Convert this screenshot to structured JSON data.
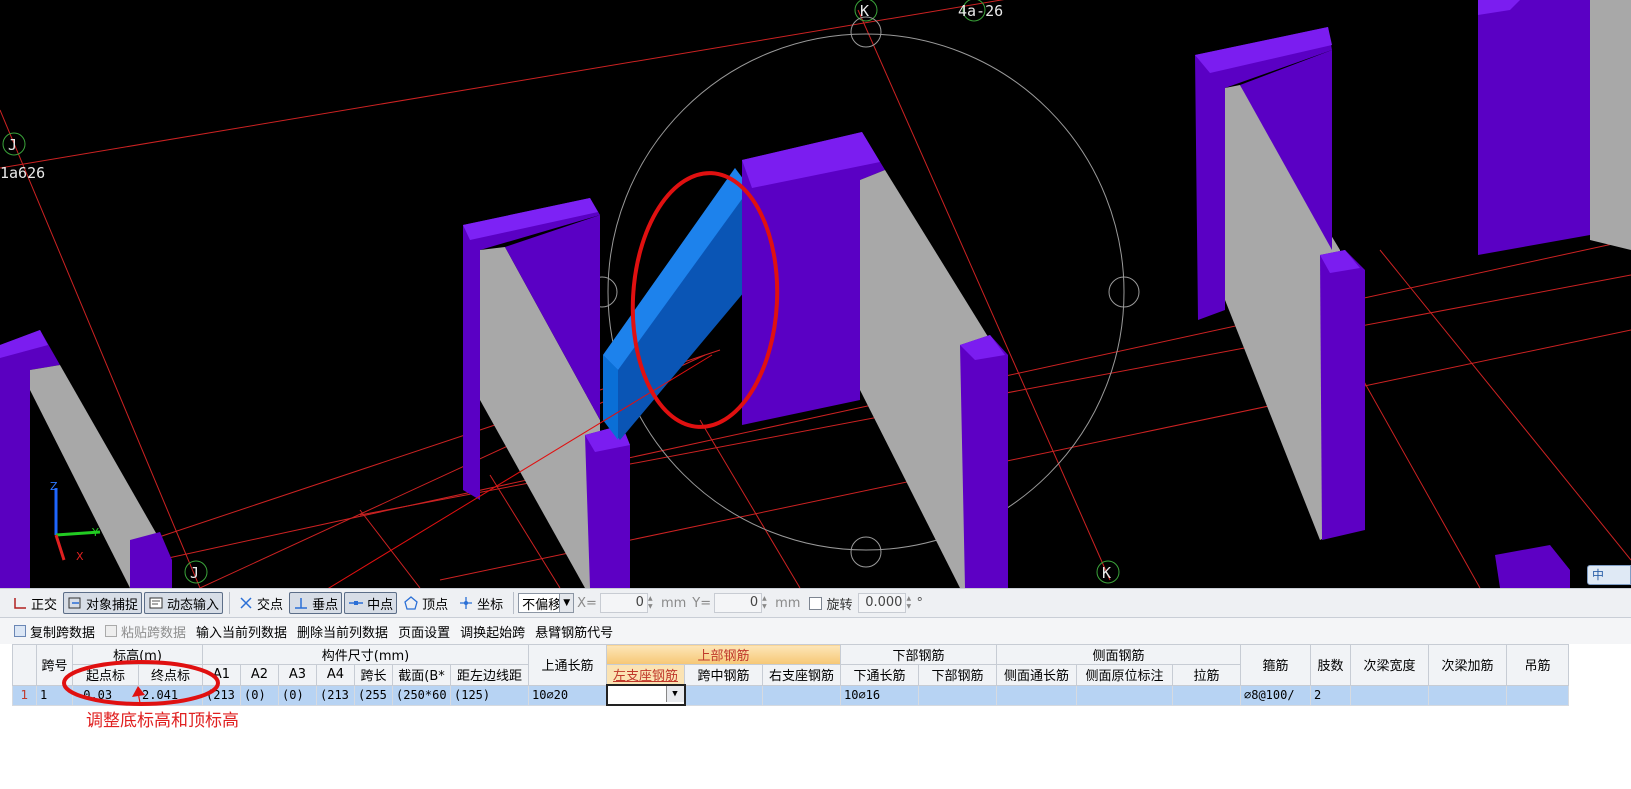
{
  "viewport": {
    "axis_labels": [
      {
        "id": "K-top",
        "text": "K"
      },
      {
        "id": "J-left",
        "text": "J"
      },
      {
        "id": "J-bottom",
        "text": "J"
      },
      {
        "id": "K-bottom",
        "text": "K"
      },
      {
        "id": "dim-top",
        "text": "4a-26"
      },
      {
        "id": "dim-left",
        "text": "1a626"
      }
    ],
    "view_indicator": "中",
    "gizmo": {
      "z": "Z",
      "y": "Y",
      "x": "X"
    },
    "colors": {
      "column_purple": "#5d00c4",
      "wall_grey": "#a8a8a8",
      "beam_blue": "#0a6fd6",
      "grid_red": "#cc2222",
      "annotation_red": "#e01010"
    }
  },
  "snap_toolbar": {
    "items": [
      {
        "label": "正交",
        "active": false
      },
      {
        "label": "对象捕捉",
        "active": true
      },
      {
        "label": "动态输入",
        "active": true
      },
      {
        "label": "交点",
        "active": false
      },
      {
        "label": "垂点",
        "active": true
      },
      {
        "label": "中点",
        "active": true
      },
      {
        "label": "顶点",
        "active": false
      },
      {
        "label": "坐标",
        "active": false
      }
    ],
    "offset_mode": "不偏移",
    "x_label": "X=",
    "x_value": "0",
    "x_unit": "mm",
    "y_label": "Y=",
    "y_value": "0",
    "y_unit": "mm",
    "rotate_label": "旋转",
    "rotate_value": "0.000",
    "degree": "°"
  },
  "table_toolbar": {
    "items": [
      {
        "label": "复制跨数据",
        "disabled": false
      },
      {
        "label": "粘贴跨数据",
        "disabled": true
      },
      {
        "label": "输入当前列数据",
        "disabled": false
      },
      {
        "label": "删除当前列数据",
        "disabled": false
      },
      {
        "label": "页面设置",
        "disabled": false
      },
      {
        "label": "调换起始跨",
        "disabled": false
      },
      {
        "label": "悬臂钢筋代号",
        "disabled": false
      }
    ]
  },
  "grid": {
    "group_headers": {
      "span_no": "跨号",
      "elevation": "标高(m)",
      "dimensions": "构件尺寸(mm)",
      "top_through": "上通长筋",
      "top_rebar": "上部钢筋",
      "bottom_rebar": "下部钢筋",
      "side_rebar": "侧面钢筋",
      "stirrup": "箍筋",
      "legs": "肢数",
      "sec_beam_width": "次梁宽度",
      "sec_beam_add": "次梁加筋",
      "hanger": "吊筋"
    },
    "sub_headers": {
      "start_elev": "起点标",
      "end_elev": "终点标",
      "a1": "A1",
      "a2": "A2",
      "a3": "A3",
      "a4": "A4",
      "span_len": "跨长",
      "section": "截面(B*",
      "edge_dist": "距左边线距",
      "left_support": "左支座钢筋",
      "mid_span": "跨中钢筋",
      "right_support": "右支座钢筋",
      "bottom_through": "下通长筋",
      "bottom_bar": "下部钢筋",
      "side_through": "侧面通长筋",
      "side_in_situ": "侧面原位标注",
      "tie_bar": "拉筋"
    },
    "rows": [
      {
        "row_no": "1",
        "span": "1",
        "start_elev": "-0.03",
        "end_elev": "2.041",
        "a1": "(213",
        "a2": "(0)",
        "a3": "(0)",
        "a4": "(213",
        "span_len": "(255",
        "section": "(250*60",
        "edge_dist": "(125)",
        "top_through": "10⌀20",
        "left_support": "",
        "mid_span": "",
        "right_support": "",
        "bottom_through": "10⌀16",
        "bottom_bar": "",
        "side_through": "",
        "side_in_situ": "",
        "tie_bar": "",
        "stirrup": "⌀8@100/",
        "legs": "2",
        "sec_beam_width": "",
        "sec_beam_add": "",
        "hanger": ""
      }
    ]
  },
  "annotation": {
    "text": "调整底标高和顶标高"
  }
}
